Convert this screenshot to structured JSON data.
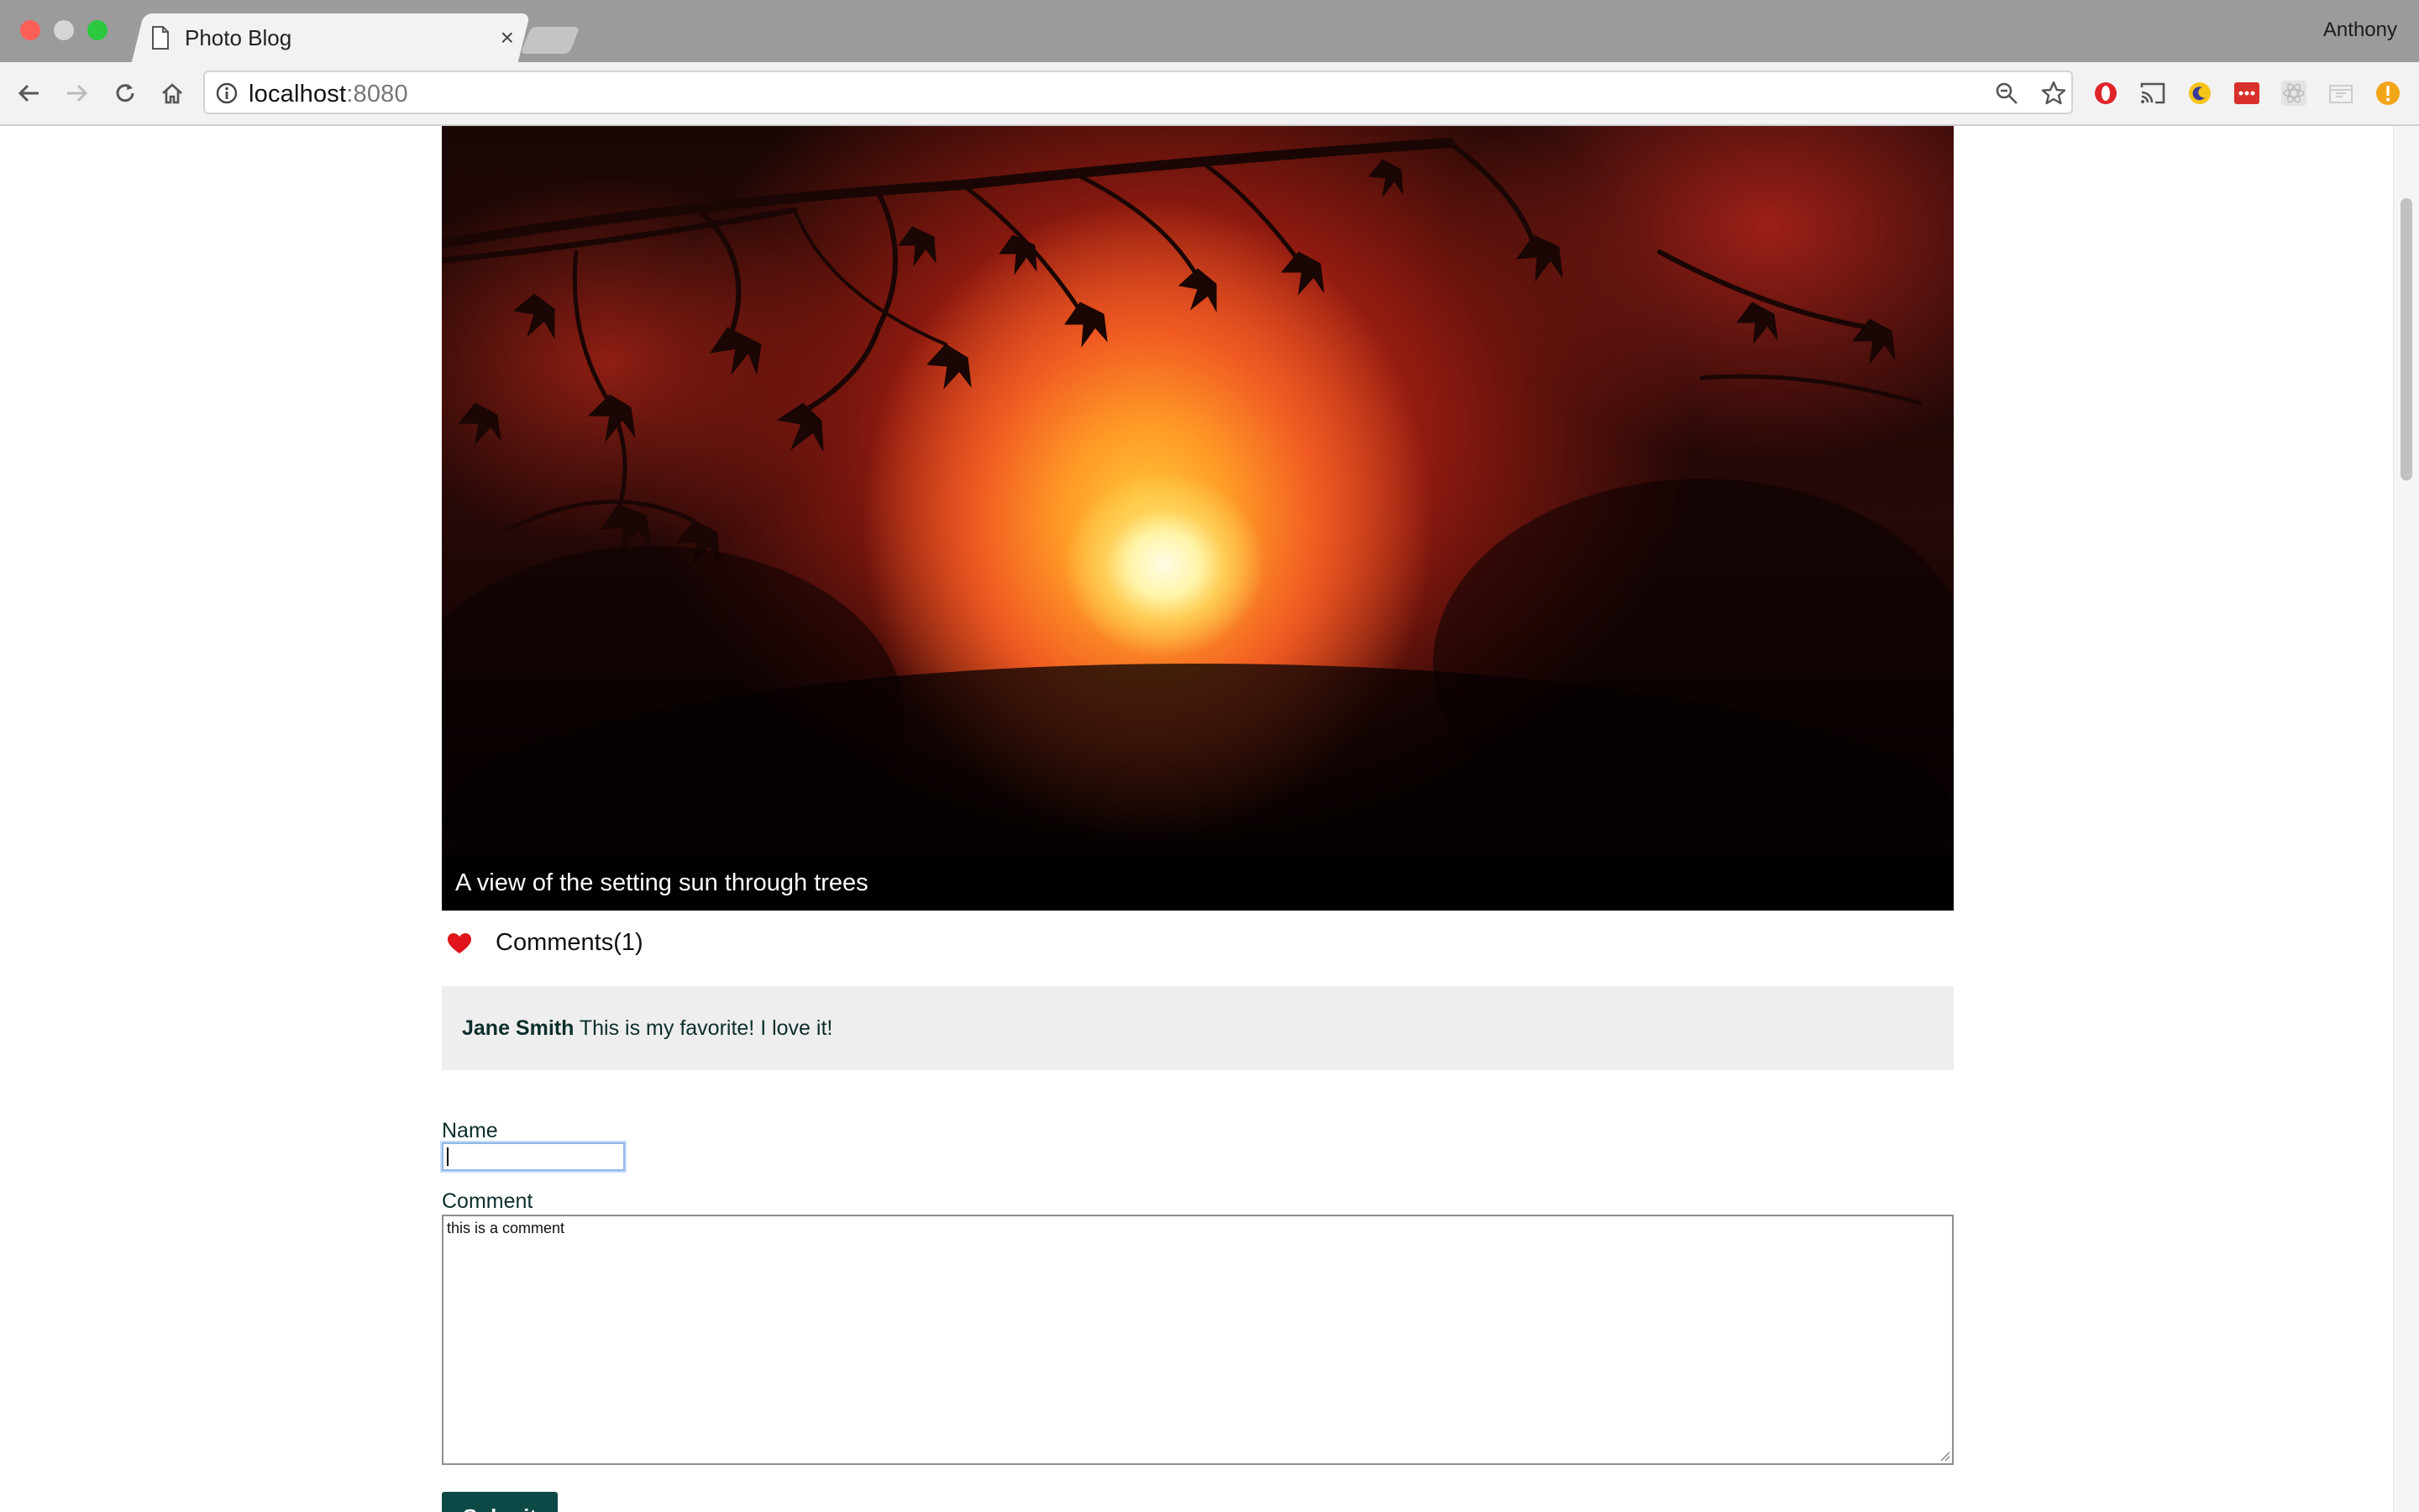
{
  "browser": {
    "tab_title": "Photo Blog",
    "tab_close": "×",
    "profile_name": "Anthony",
    "url_host": "localhost",
    "url_port": ":8080"
  },
  "post": {
    "caption": "A view of the setting sun through trees",
    "comments_label": "Comments(1)",
    "comments": [
      {
        "author": "Jane Smith",
        "text": "This is my favorite! I love it!"
      }
    ]
  },
  "form": {
    "name_label": "Name",
    "name_value": "",
    "comment_label": "Comment",
    "comment_value": "this is a comment",
    "submit_label": "Submit"
  },
  "colors": {
    "heart": "#e0141a",
    "submit_bg": "#0d4a47",
    "comment_bg": "#eeeeee"
  },
  "icons": [
    "page-icon",
    "back-arrow-icon",
    "forward-arrow-icon",
    "reload-icon",
    "home-icon",
    "info-icon",
    "zoom-icon",
    "star-icon",
    "opera-icon",
    "cast-icon",
    "moon-extension-icon",
    "lastpass-icon",
    "react-devtools-icon",
    "extension-icon",
    "alert-icon",
    "heart-icon"
  ]
}
